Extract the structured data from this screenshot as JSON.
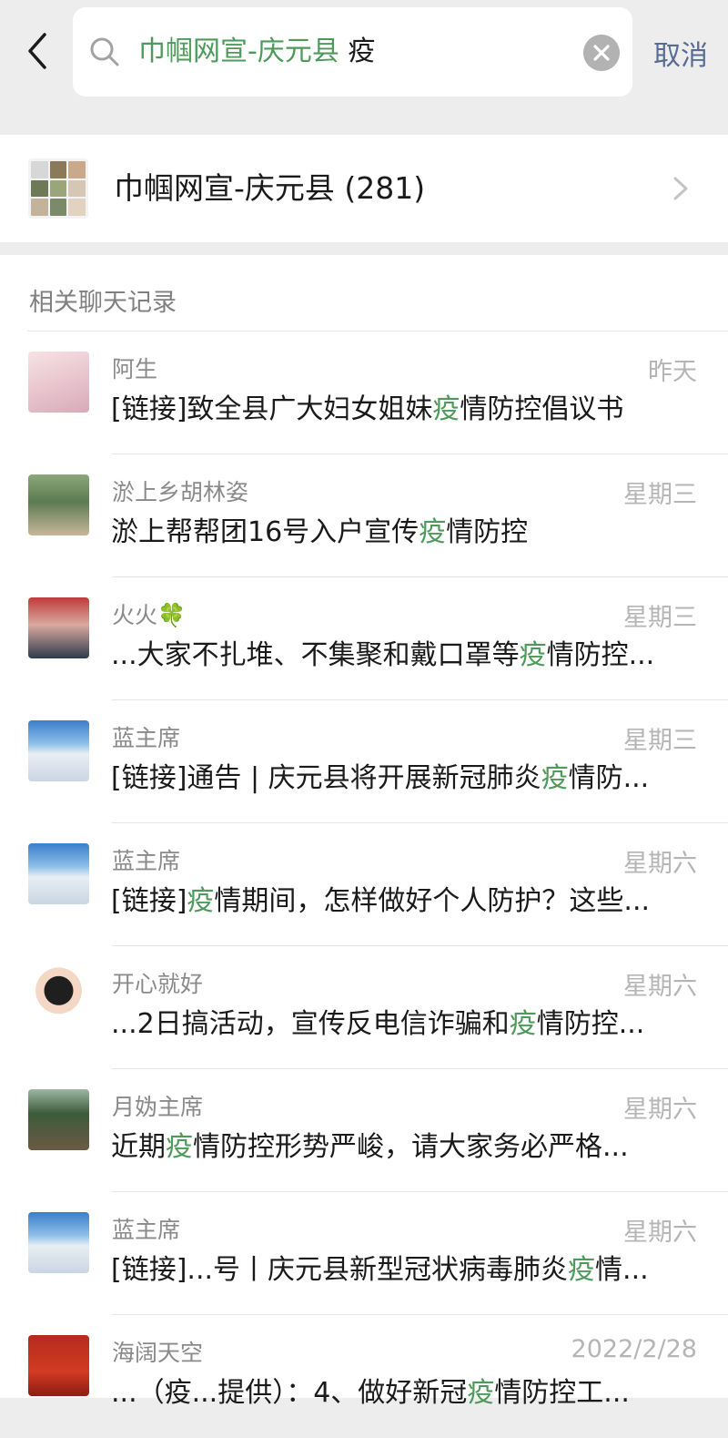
{
  "search": {
    "query_group": "巾帼网宣-庆元县",
    "query_keyword": "疫",
    "cancel_label": "取消"
  },
  "group": {
    "name": "巾帼网宣-庆元县 (281)"
  },
  "section_title": "相关聊天记录",
  "chats": [
    {
      "name": "阿生",
      "time": "昨天",
      "pre": "[链接]致全县广大妇女姐妹",
      "hl": "疫",
      "post": "情防控倡议书",
      "avatar": "anime"
    },
    {
      "name": "淤上乡胡林姿",
      "time": "星期三",
      "pre": "淤上帮帮团16号入户宣传",
      "hl": "疫",
      "post": "情防控",
      "avatar": "photo1"
    },
    {
      "name": "火火🍀",
      "time": "星期三",
      "pre": "...大家不扎堆、不集聚和戴口罩等",
      "hl": "疫",
      "post": "情防控...",
      "avatar": "photo2"
    },
    {
      "name": "蓝主席",
      "time": "星期三",
      "pre": "[链接]通告 | 庆元县将开展新冠肺炎",
      "hl": "疫",
      "post": "情防...",
      "avatar": "snow"
    },
    {
      "name": "蓝主席",
      "time": "星期六",
      "pre": "[链接]",
      "hl": "疫",
      "post": "情期间，怎样做好个人防护？这些...",
      "avatar": "snow"
    },
    {
      "name": "开心就好",
      "time": "星期六",
      "pre": "...2日搞活动，宣传反电信诈骗和",
      "hl": "疫",
      "post": "情防控...",
      "avatar": "girl"
    },
    {
      "name": "月妫主席",
      "time": "星期六",
      "pre": "近期",
      "hl": "疫",
      "post": "情防控形势严峻，请大家务必严格...",
      "avatar": "tree"
    },
    {
      "name": "蓝主席",
      "time": "星期六",
      "pre": "[链接]...号丨庆元县新型冠状病毒肺炎",
      "hl": "疫",
      "post": "情...",
      "avatar": "snow"
    },
    {
      "name": "海阔天空",
      "time": "2022/2/28",
      "pre": "...（疫...提供）：4、做好新冠",
      "hl": "疫",
      "post": "情防控工...",
      "avatar": "red"
    }
  ],
  "colors": {
    "highlight": "#4e9a5b",
    "cancel": "#576b95",
    "background": "#ededed"
  },
  "icons": {
    "back": "chevron-left-icon",
    "search": "search-icon",
    "clear": "clear-icon",
    "more": "chevron-right-icon"
  }
}
